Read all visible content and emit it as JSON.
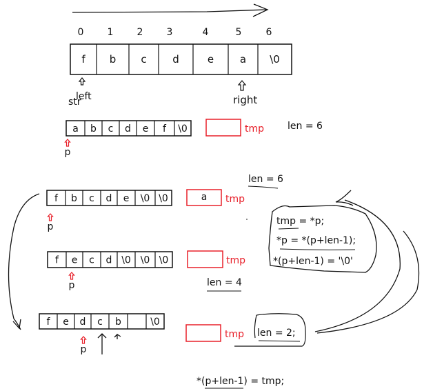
{
  "top_array": {
    "indices": [
      "0",
      "1",
      "2",
      "3",
      "4",
      "5",
      "6"
    ],
    "cells": [
      "f",
      "b",
      "c",
      "d",
      "e",
      "a",
      "\\0"
    ],
    "left_label": "left",
    "right_label": "right"
  },
  "str_label": "str",
  "rows": [
    {
      "cells": [
        "a",
        "b",
        "c",
        "d",
        "e",
        "f",
        "\\0"
      ],
      "tmp_value": "",
      "tmp_label": "tmp",
      "pointer": "p"
    },
    {
      "cells": [
        "f",
        "b",
        "c",
        "d",
        "e",
        "\\0",
        "\\0"
      ],
      "tmp_value": "a",
      "tmp_label": "tmp",
      "pointer": "p"
    },
    {
      "cells": [
        "f",
        "e",
        "c",
        "d",
        "\\0",
        "\\0",
        "\\0"
      ],
      "tmp_value": "",
      "tmp_label": "tmp",
      "pointer": "p"
    },
    {
      "cells": [
        "f",
        "e",
        "d",
        "c",
        "b",
        "",
        "\\0"
      ],
      "tmp_value": "",
      "tmp_label": "tmp",
      "pointer": "p"
    }
  ],
  "len_labels": {
    "first": "len = 6",
    "second": "len = 6",
    "third": "len = 4",
    "fourth": "len = 2;"
  },
  "code": {
    "line1": "tmp = *p;",
    "line2": "*p = *(p+len-1);",
    "line3": "*(p+len-1) = '\\0'",
    "final": "*(p+len-1) = tmp;"
  },
  "colors": {
    "accent": "#e8202a",
    "ink": "#111111"
  }
}
